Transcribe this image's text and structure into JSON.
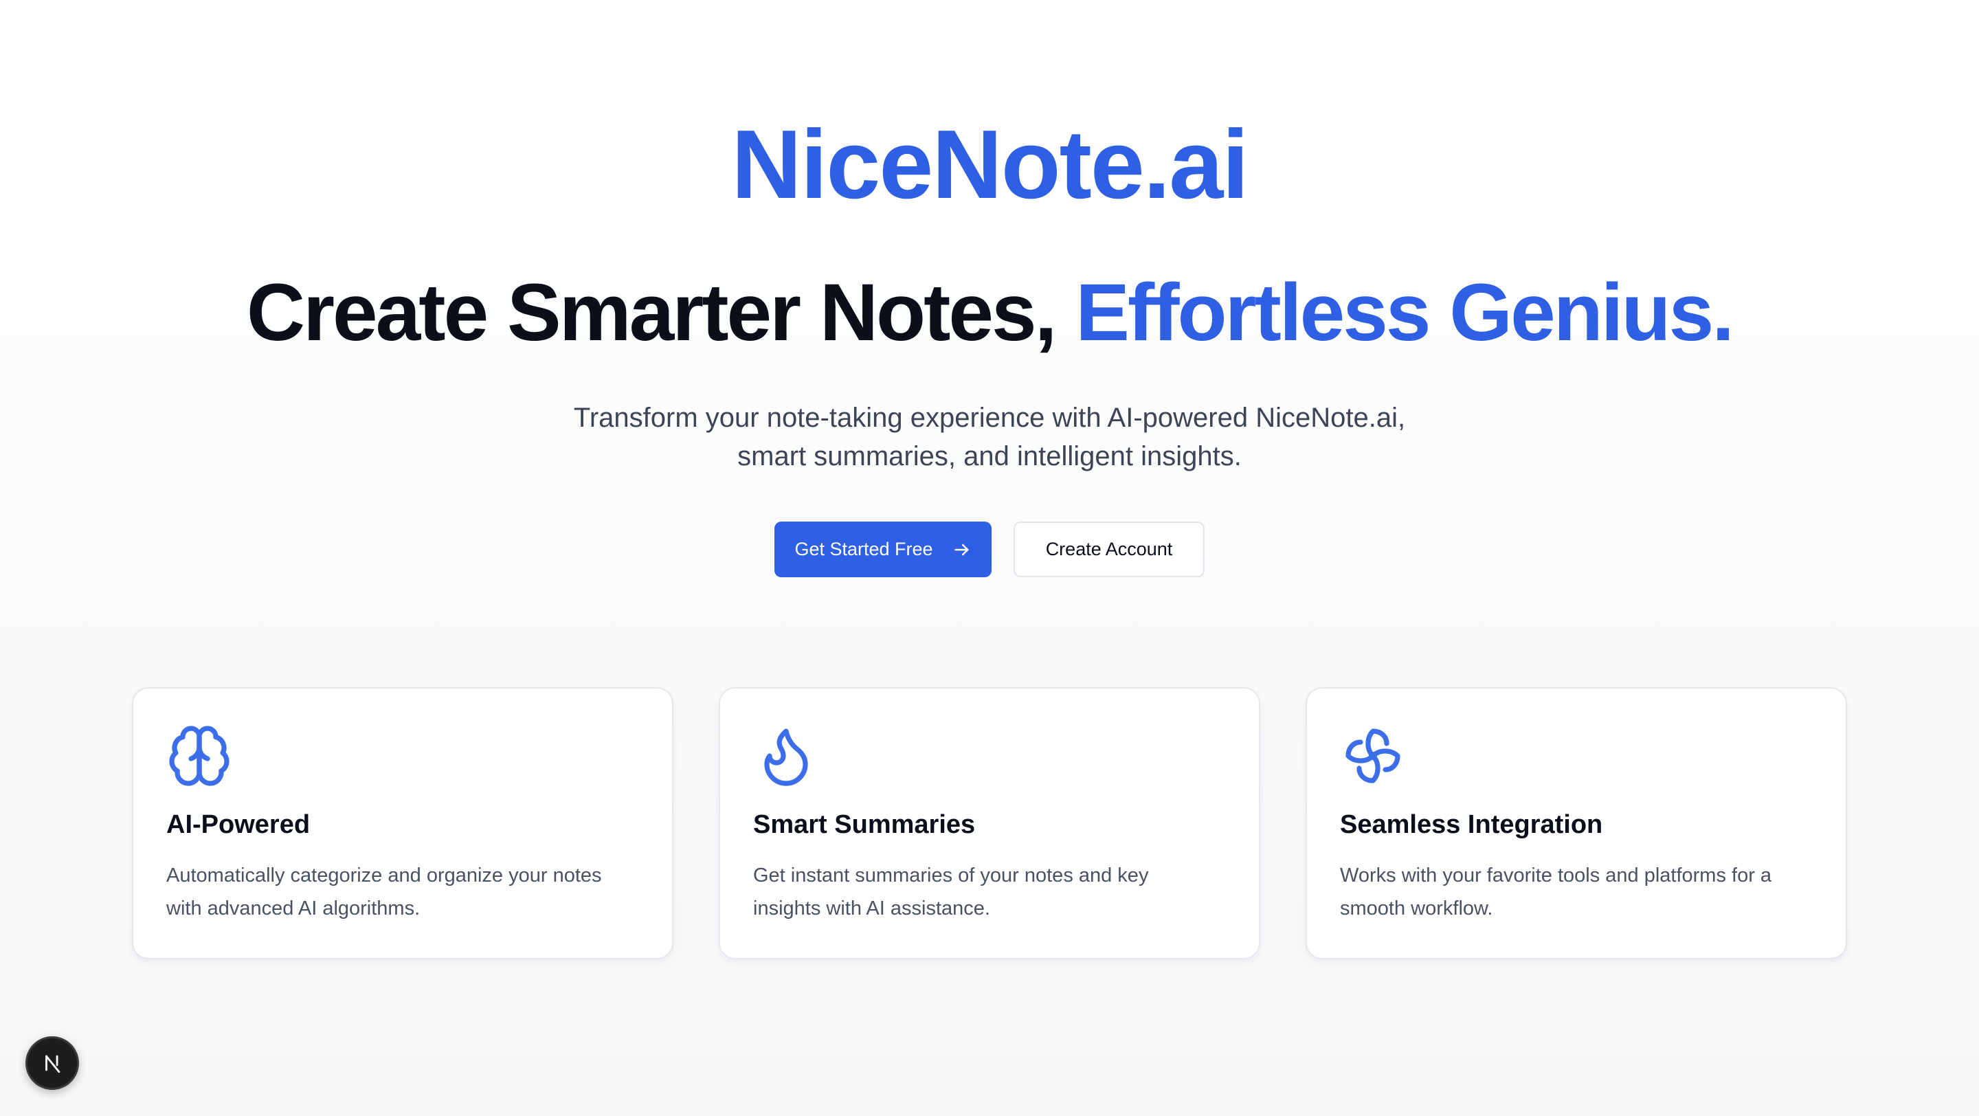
{
  "brand": {
    "name": "NiceNote.ai",
    "color": "#2f5fe3"
  },
  "hero": {
    "headline_dark": "Create Smarter Notes,",
    "headline_blue": "Effortless Genius.",
    "subtitle": "Transform your note-taking experience with AI-powered NiceNote.ai, smart summaries, and intelligent insights."
  },
  "cta": {
    "primary_label": "Get Started Free",
    "primary_icon": "arrow-right-icon",
    "secondary_label": "Create Account"
  },
  "features": [
    {
      "icon": "brain-icon",
      "title": "AI-Powered",
      "description": "Automatically categorize and organize your notes with advanced AI algorithms."
    },
    {
      "icon": "flame-icon",
      "title": "Smart Summaries",
      "description": "Get instant summaries of your notes and key insights with AI assistance."
    },
    {
      "icon": "pinwheel-icon",
      "title": "Seamless Integration",
      "description": "Works with your favorite tools and platforms for a smooth workflow."
    }
  ],
  "dev_badge": {
    "icon": "nextjs-logo-icon"
  },
  "colors": {
    "accent": "#2f5fe3",
    "icon": "#3b6ee8",
    "text_dark": "#0b0f1a",
    "text_muted": "#4a5163"
  }
}
